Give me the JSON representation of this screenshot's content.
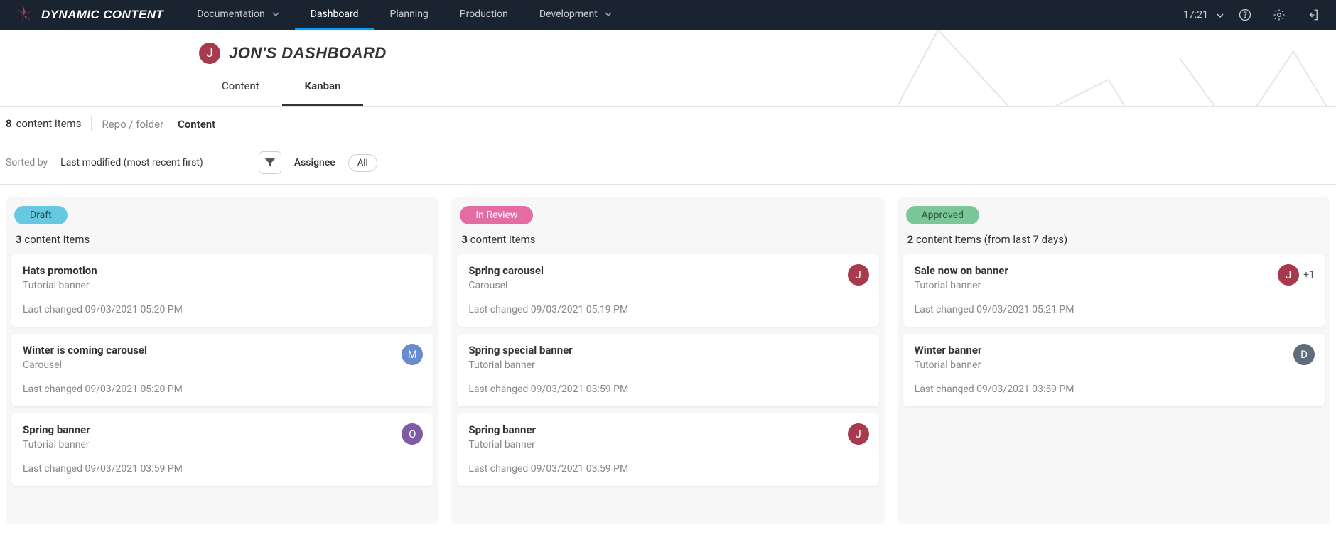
{
  "brand": {
    "name": "DYNAMIC CONTENT"
  },
  "nav": [
    {
      "label": "Documentation",
      "dropdown": true,
      "active": false
    },
    {
      "label": "Dashboard",
      "dropdown": false,
      "active": true
    },
    {
      "label": "Planning",
      "dropdown": false,
      "active": false
    },
    {
      "label": "Production",
      "dropdown": false,
      "active": false
    },
    {
      "label": "Development",
      "dropdown": true,
      "active": false
    }
  ],
  "clock": {
    "time": "17:21"
  },
  "header": {
    "avatar": {
      "letter": "J",
      "bg": "#a73a4c"
    },
    "title": "JON'S DASHBOARD",
    "tabs": [
      {
        "label": "Content",
        "active": false
      },
      {
        "label": "Kanban",
        "active": true
      }
    ]
  },
  "status": {
    "total_count": "8",
    "total_label": "content items",
    "breadcrumb_root": "Repo / folder",
    "breadcrumb_current": "Content",
    "sorted_by_label": "Sorted by",
    "sorted_by_value": "Last modified (most recent first)",
    "assignee_label": "Assignee",
    "assignee_chip": "All"
  },
  "colors": {
    "draft_bg": "#66c9e0",
    "draft_fg": "#2b4a54",
    "review_bg": "#e36ca4",
    "review_fg": "#ffffff",
    "approved_bg": "#7cc79a",
    "approved_fg": "#2c5a3c",
    "avatar_j": "#a73a4c",
    "avatar_m": "#6b8bce",
    "avatar_o": "#7f5ba6",
    "avatar_d": "#5f6d7b"
  },
  "columns": [
    {
      "name": "Draft",
      "count": "3",
      "count_label": "content items",
      "count_extra": "",
      "badge_bg_key": "draft_bg",
      "badge_fg_key": "draft_fg",
      "cards": [
        {
          "title": "Hats promotion",
          "sub": "Tutorial banner",
          "changed": "Last changed 09/03/2021 05:20 PM",
          "avatars": [],
          "extra": ""
        },
        {
          "title": "Winter is coming carousel",
          "sub": "Carousel",
          "changed": "Last changed 09/03/2021 05:20 PM",
          "avatars": [
            {
              "letter": "M",
              "bg_key": "avatar_m"
            }
          ],
          "extra": ""
        },
        {
          "title": "Spring banner",
          "sub": "Tutorial banner",
          "changed": "Last changed 09/03/2021 03:59 PM",
          "avatars": [
            {
              "letter": "O",
              "bg_key": "avatar_o"
            }
          ],
          "extra": ""
        }
      ]
    },
    {
      "name": "In Review",
      "count": "3",
      "count_label": "content items",
      "count_extra": "",
      "badge_bg_key": "review_bg",
      "badge_fg_key": "review_fg",
      "cards": [
        {
          "title": "Spring carousel",
          "sub": "Carousel",
          "changed": "Last changed 09/03/2021 05:19 PM",
          "avatars": [
            {
              "letter": "J",
              "bg_key": "avatar_j"
            }
          ],
          "extra": ""
        },
        {
          "title": "Spring special banner",
          "sub": "Tutorial banner",
          "changed": "Last changed 09/03/2021 03:59 PM",
          "avatars": [],
          "extra": ""
        },
        {
          "title": "Spring banner",
          "sub": "Tutorial banner",
          "changed": "Last changed 09/03/2021 03:59 PM",
          "avatars": [
            {
              "letter": "J",
              "bg_key": "avatar_j"
            }
          ],
          "extra": ""
        }
      ]
    },
    {
      "name": "Approved",
      "count": "2",
      "count_label": "content items",
      "count_extra": "(from last 7 days)",
      "badge_bg_key": "approved_bg",
      "badge_fg_key": "approved_fg",
      "cards": [
        {
          "title": "Sale now on banner",
          "sub": "Tutorial banner",
          "changed": "Last changed 09/03/2021 05:21 PM",
          "avatars": [
            {
              "letter": "J",
              "bg_key": "avatar_j"
            }
          ],
          "extra": "+1"
        },
        {
          "title": "Winter banner",
          "sub": "Tutorial banner",
          "changed": "Last changed 09/03/2021 03:59 PM",
          "avatars": [
            {
              "letter": "D",
              "bg_key": "avatar_d"
            }
          ],
          "extra": ""
        }
      ]
    }
  ]
}
